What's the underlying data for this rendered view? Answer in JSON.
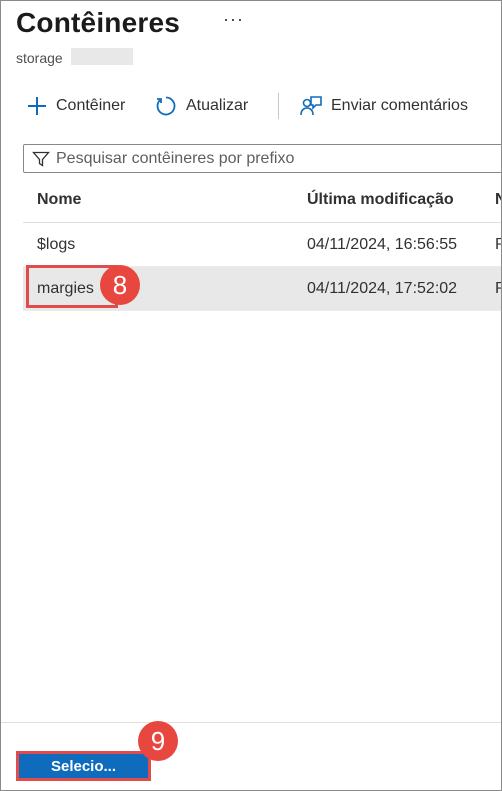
{
  "page": {
    "title": "Contêineres",
    "more_label": "···",
    "subtitle": "storage"
  },
  "toolbar": {
    "add_label": "Contêiner",
    "refresh_label": "Atualizar",
    "feedback_label": "Enviar comentários"
  },
  "search": {
    "placeholder": "Pesquisar contêineres por prefixo",
    "value": ""
  },
  "table": {
    "columns": [
      "Nome",
      "Última modificação",
      "N"
    ],
    "rows": [
      {
        "name": "$logs",
        "modified": "04/11/2024, 16:56:55",
        "extra": "P"
      },
      {
        "name": "margies",
        "modified": "04/11/2024, 17:52:02",
        "extra": "P",
        "selected": true
      }
    ]
  },
  "annotations": {
    "step_8": "8",
    "step_9": "9"
  },
  "footer": {
    "select_label": "Selecio..."
  },
  "colors": {
    "accent": "#0f6cbd",
    "annotation_red": "#e8473f",
    "selected_row": "#e8e8e8"
  }
}
